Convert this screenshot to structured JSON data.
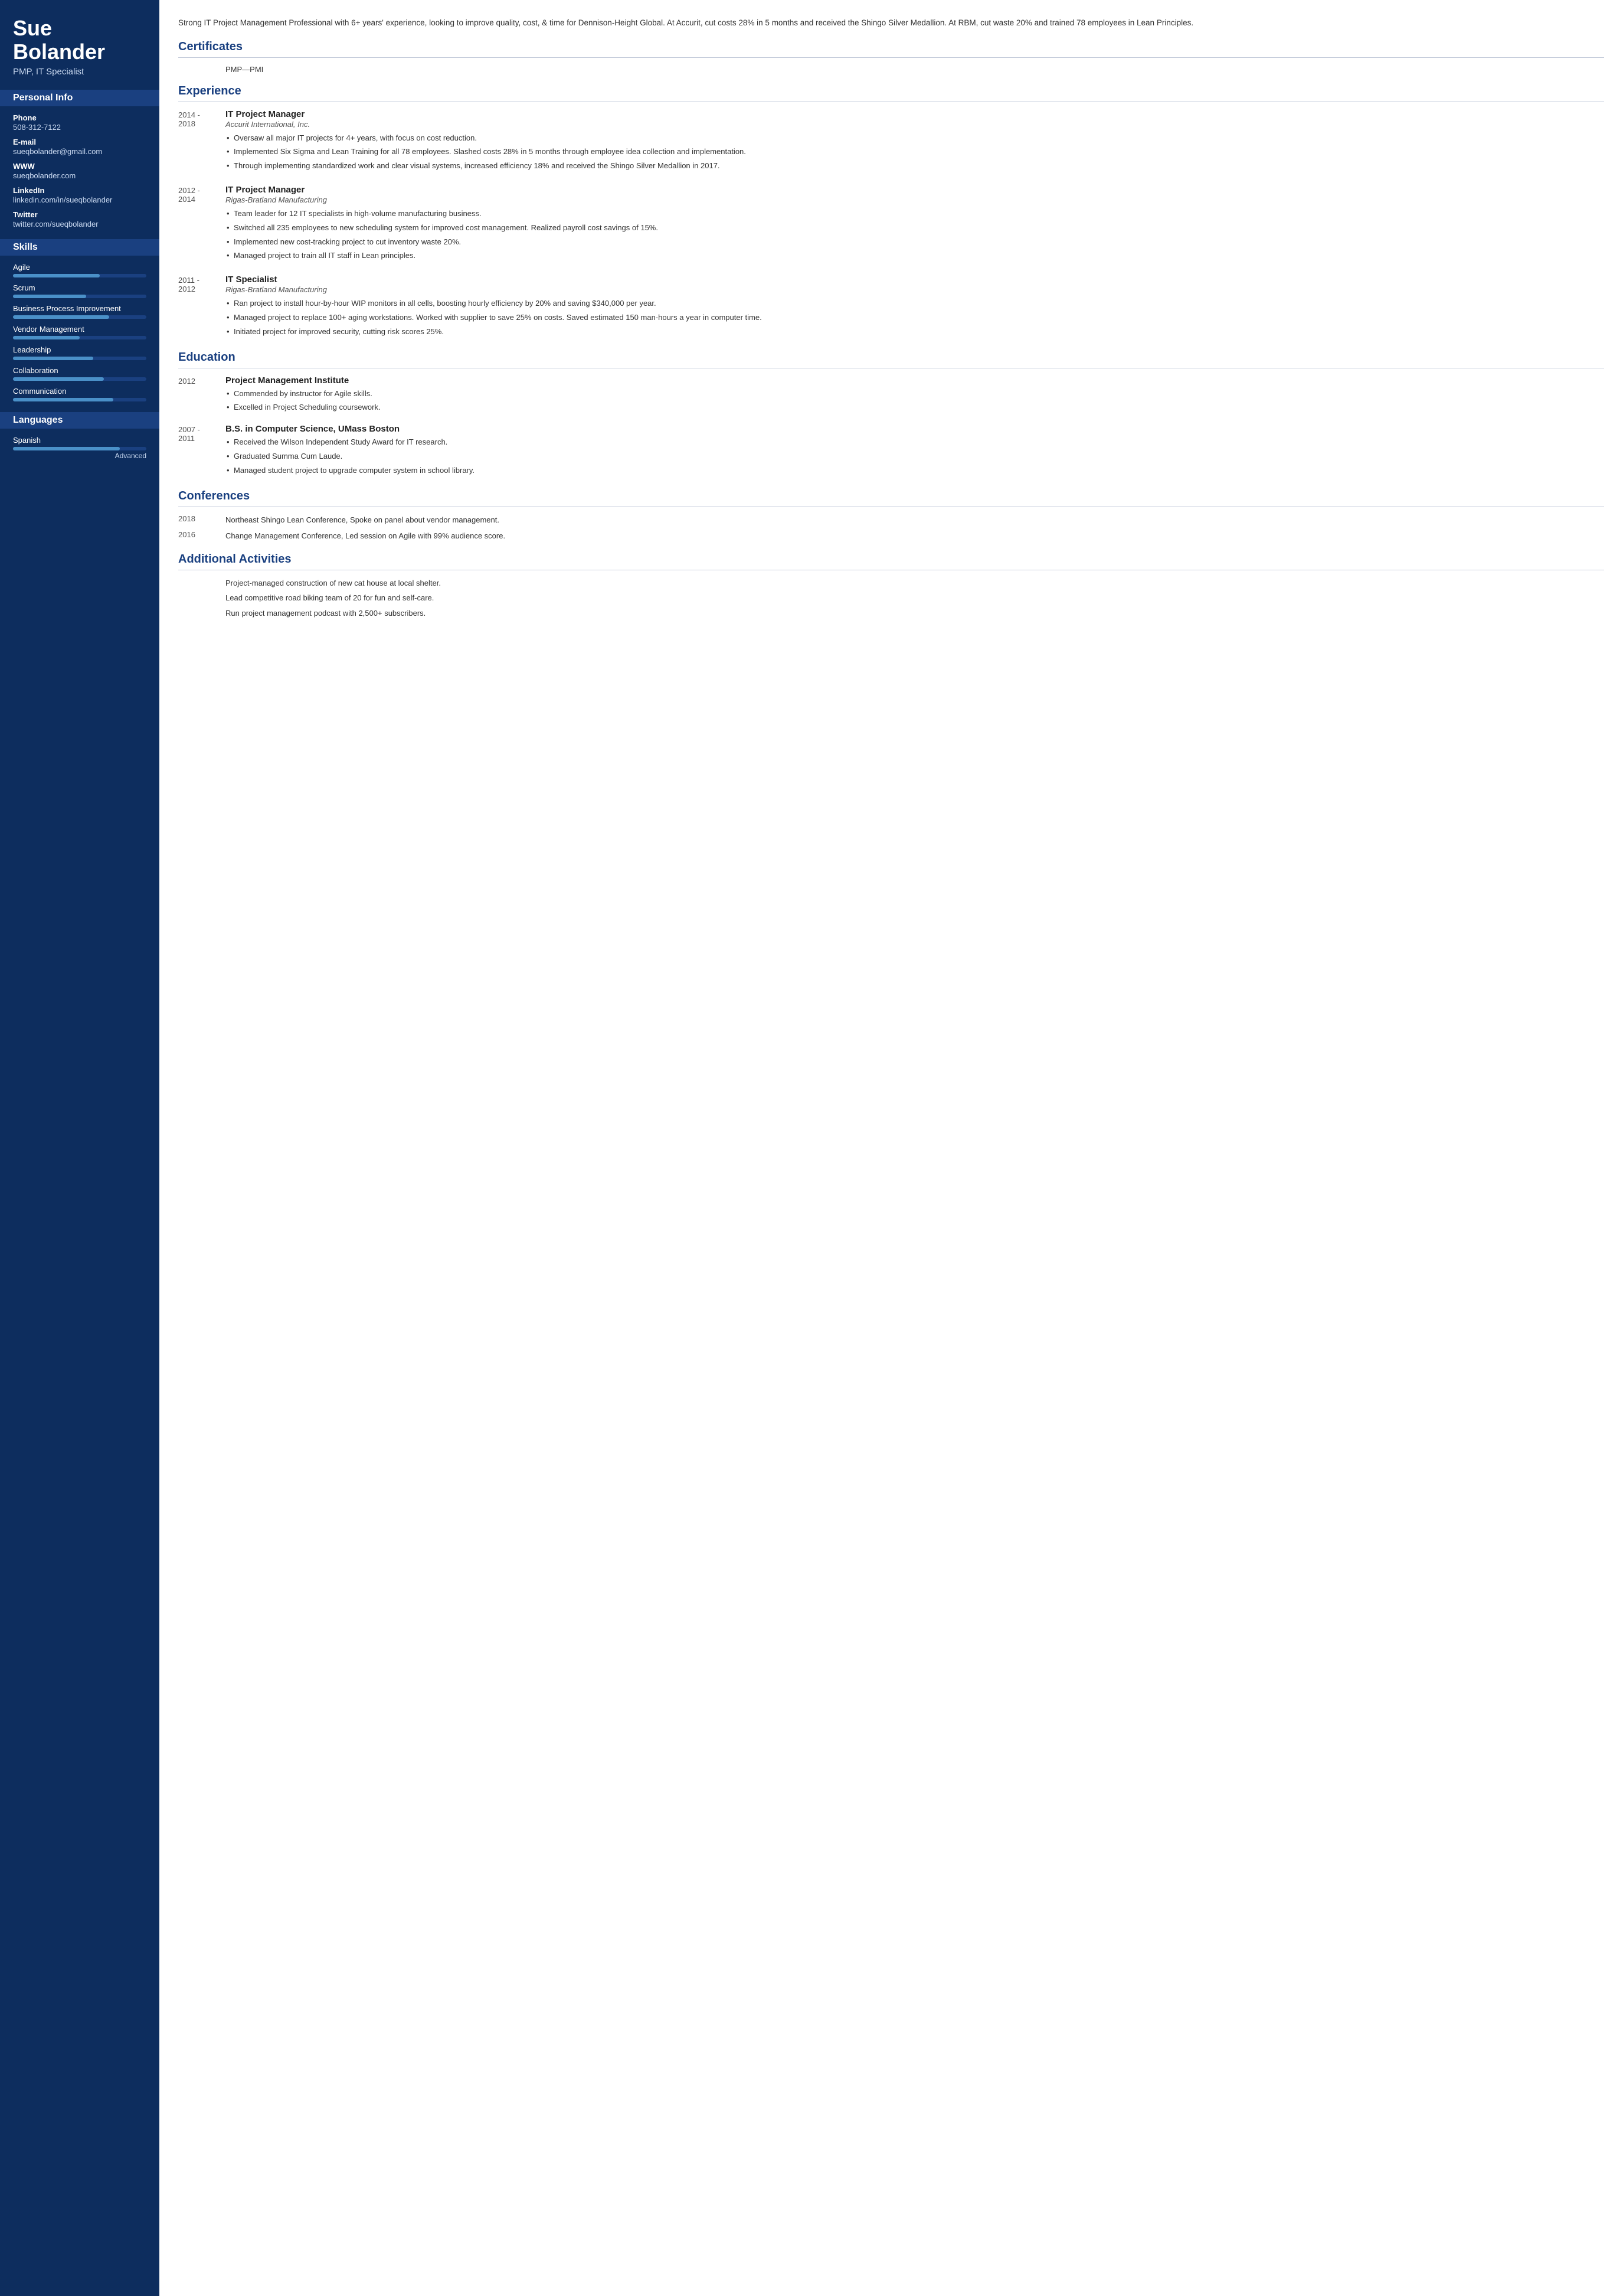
{
  "sidebar": {
    "name_line1": "Sue",
    "name_line2": "Bolander",
    "title": "PMP, IT Specialist",
    "sections": {
      "personal_info": "Personal Info",
      "skills": "Skills",
      "languages": "Languages"
    },
    "contact": [
      {
        "label": "Phone",
        "value": "508-312-7122"
      },
      {
        "label": "E-mail",
        "value": "sueqbolander@gmail.com"
      },
      {
        "label": "WWW",
        "value": "sueqbolander.com"
      },
      {
        "label": "LinkedIn",
        "value": "linkedin.com/in/sueqbolander"
      },
      {
        "label": "Twitter",
        "value": "twitter.com/sueqbolander"
      }
    ],
    "skills": [
      {
        "name": "Agile",
        "fill": 65
      },
      {
        "name": "Scrum",
        "fill": 55
      },
      {
        "name": "Business Process Improvement",
        "fill": 72
      },
      {
        "name": "Vendor Management",
        "fill": 50
      },
      {
        "name": "Leadership",
        "fill": 60
      },
      {
        "name": "Collaboration",
        "fill": 68
      },
      {
        "name": "Communication",
        "fill": 75
      }
    ],
    "languages": [
      {
        "name": "Spanish",
        "fill": 80,
        "level": "Advanced"
      }
    ]
  },
  "main": {
    "summary": "Strong IT Project Management Professional with 6+ years' experience, looking to improve quality, cost, & time for Dennison-Height Global. At Accurit, cut costs 28% in 5 months and received the Shingo Silver Medallion. At RBM, cut waste 20% and trained 78 employees in Lean Principles.",
    "certificates_title": "Certificates",
    "certificates": [
      {
        "year": "",
        "name": "PMP—PMI"
      }
    ],
    "experience_title": "Experience",
    "experience": [
      {
        "dates": "2014 - 2018",
        "job_title": "IT Project Manager",
        "company": "Accurit International, Inc.",
        "bullets": [
          "Oversaw all major IT projects for 4+ years, with focus on cost reduction.",
          "Implemented Six Sigma and Lean Training for all 78 employees. Slashed costs 28% in 5 months through employee idea collection and implementation.",
          "Through implementing standardized work and clear visual systems, increased efficiency 18% and received the Shingo Silver Medallion in 2017."
        ]
      },
      {
        "dates": "2012 - 2014",
        "job_title": "IT Project Manager",
        "company": "Rigas-Bratland Manufacturing",
        "bullets": [
          "Team leader for 12 IT specialists in high-volume manufacturing business.",
          "Switched all 235 employees to new scheduling system for improved cost management. Realized payroll cost savings of 15%.",
          "Implemented new cost-tracking project to cut inventory waste 20%.",
          "Managed project to train all IT staff in Lean principles."
        ]
      },
      {
        "dates": "2011 - 2012",
        "job_title": "IT Specialist",
        "company": "Rigas-Bratland Manufacturing",
        "bullets": [
          "Ran project to install hour-by-hour WIP monitors in all cells, boosting hourly efficiency by 20% and saving $340,000 per year.",
          "Managed project to replace 100+ aging workstations. Worked with supplier to save 25% on costs. Saved estimated 150 man-hours a year in computer time.",
          "Initiated project for improved security, cutting risk scores 25%."
        ]
      }
    ],
    "education_title": "Education",
    "education": [
      {
        "dates": "2012",
        "title": "Project Management Institute",
        "bullets": [
          "Commended by instructor for Agile skills.",
          "Excelled in Project Scheduling coursework."
        ]
      },
      {
        "dates": "2007 - 2011",
        "title": "B.S. in Computer Science, UMass Boston",
        "bullets": [
          "Received the Wilson Independent Study Award for IT research.",
          "Graduated Summa Cum Laude.",
          "Managed student project to upgrade computer system in school library."
        ]
      }
    ],
    "conferences_title": "Conferences",
    "conferences": [
      {
        "year": "2018",
        "text": "Northeast Shingo Lean Conference, Spoke on panel about vendor management."
      },
      {
        "year": "2016",
        "text": "Change Management Conference, Led session on Agile with 99% audience score."
      }
    ],
    "activities_title": "Additional Activities",
    "activities": [
      "Project-managed construction of new cat house at local shelter.",
      "Lead competitive road biking team of 20 for fun and self-care.",
      "Run project management podcast with 2,500+ subscribers."
    ]
  }
}
